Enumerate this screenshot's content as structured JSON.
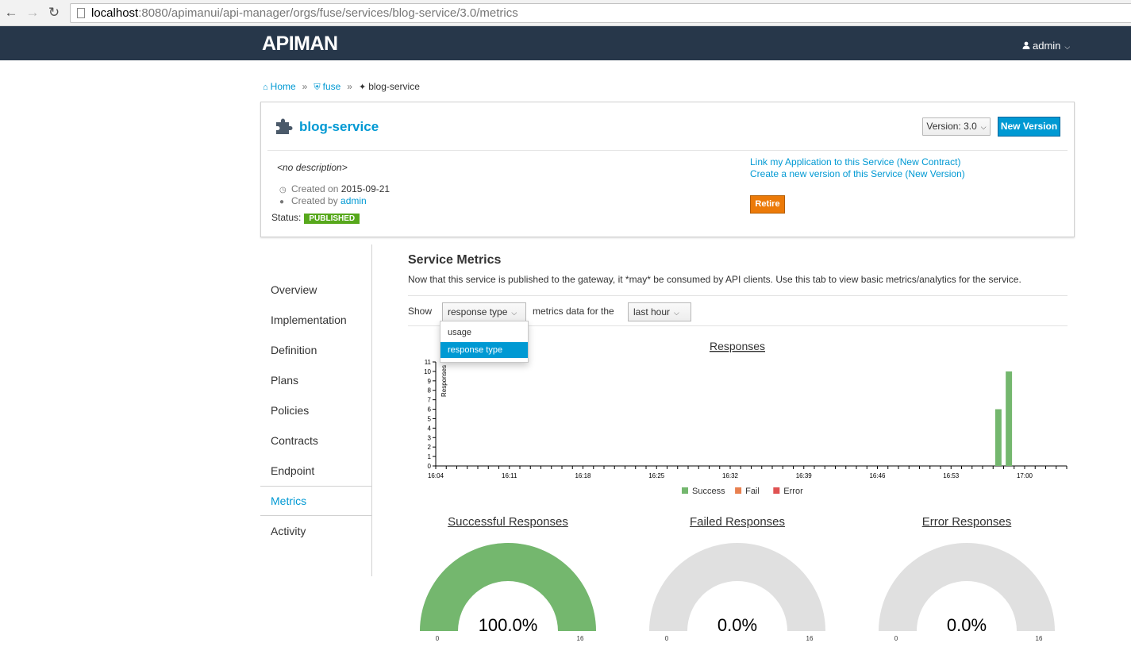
{
  "browser": {
    "url_host": "localhost",
    "url_rest": ":8080/apimanui/api-manager/orgs/fuse/services/blog-service/3.0/metrics"
  },
  "app": {
    "logo": "APIMAN",
    "user": "admin"
  },
  "breadcrumb": {
    "home": "Home",
    "org": "fuse",
    "service": "blog-service"
  },
  "service": {
    "name": "blog-service",
    "version_label": "Version: 3.0",
    "new_version": "New Version",
    "description": "<no description>",
    "created_on_label": "Created on",
    "created_on": "2015-09-21",
    "created_by_label": "Created by",
    "created_by": "admin",
    "status_label": "Status:",
    "status": "PUBLISHED",
    "link_contract": "Link my Application to this Service (New Contract)",
    "link_new_version": "Create a new version of this Service (New Version)",
    "retire": "Retire"
  },
  "nav": {
    "items": [
      "Overview",
      "Implementation",
      "Definition",
      "Plans",
      "Policies",
      "Contracts",
      "Endpoint",
      "Metrics",
      "Activity"
    ],
    "active": "Metrics"
  },
  "metrics": {
    "title": "Service Metrics",
    "description": "Now that this service is published to the gateway, it *may* be consumed by API clients. Use this tab to view basic metrics/analytics for the service.",
    "show_label": "Show",
    "type_selected": "response type",
    "middle_label": "metrics data for the",
    "period_selected": "last hour",
    "type_options": [
      "usage",
      "response type"
    ]
  },
  "colors": {
    "success": "#74b76e",
    "fail": "#e8804f",
    "error": "#e05252",
    "empty": "#e0e0e0",
    "accent": "#0099d3"
  },
  "chart_data": [
    {
      "type": "bar",
      "title": "Responses",
      "ylabel": "Responses",
      "ylim": [
        0,
        11
      ],
      "yticks": [
        0,
        1,
        2,
        3,
        4,
        5,
        6,
        7,
        8,
        9,
        10,
        11
      ],
      "x_tick_labels": [
        "16:04",
        "16:11",
        "16:18",
        "16:25",
        "16:32",
        "16:39",
        "16:46",
        "16:53",
        "17:00"
      ],
      "x_range_minutes": [
        0,
        60
      ],
      "x_label_minutes": [
        0,
        7,
        14,
        21,
        28,
        35,
        42,
        49,
        56
      ],
      "series": [
        {
          "name": "Success",
          "points": [
            {
              "minute": 53.5,
              "value": 6
            },
            {
              "minute": 54.5,
              "value": 10
            }
          ]
        },
        {
          "name": "Fail",
          "points": []
        },
        {
          "name": "Error",
          "points": []
        }
      ]
    },
    {
      "type": "gauge",
      "title": "Successful Responses",
      "value": 16,
      "min": 0,
      "max": 16,
      "label": "100.0%",
      "min_label": "0",
      "max_label": "16",
      "color_key": "success"
    },
    {
      "type": "gauge",
      "title": "Failed Responses",
      "value": 0,
      "min": 0,
      "max": 16,
      "label": "0.0%",
      "min_label": "0",
      "max_label": "16",
      "color_key": "fail"
    },
    {
      "type": "gauge",
      "title": "Error Responses",
      "value": 0,
      "min": 0,
      "max": 16,
      "label": "0.0%",
      "min_label": "0",
      "max_label": "16",
      "color_key": "error"
    }
  ]
}
